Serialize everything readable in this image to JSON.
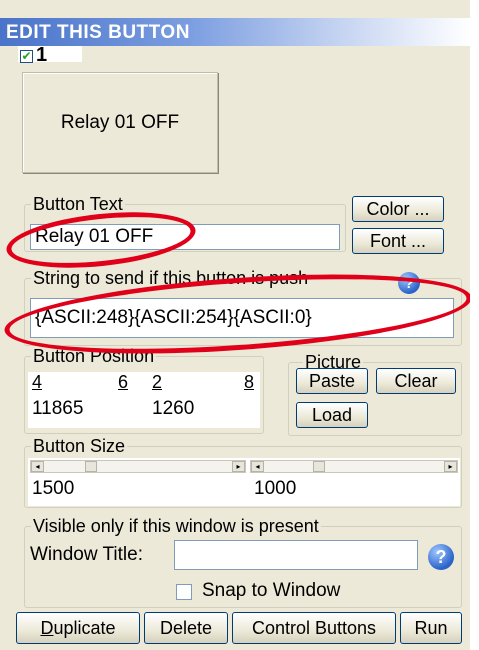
{
  "title": "EDIT THIS BUTTON",
  "button_number": "1",
  "button_enabled_checked": true,
  "preview_label": "Relay 01 OFF",
  "button_text": {
    "legend": "Button Text",
    "value": "Relay 01 OFF",
    "color_button": "Color ...",
    "font_button": "Font ..."
  },
  "string": {
    "legend": "String to send if this button is push",
    "value": "{ASCII:248}{ASCII:254}{ASCII:0}"
  },
  "position": {
    "legend": "Button Position",
    "labels": [
      "4",
      "6",
      "2",
      "8"
    ],
    "x_value": "11865",
    "y_value": "1260"
  },
  "picture": {
    "legend": "Picture",
    "paste": "Paste",
    "clear": "Clear",
    "load": "Load"
  },
  "size": {
    "legend": "Button Size",
    "width_value": "1500",
    "height_value": "1000"
  },
  "visible": {
    "legend": "Visible only if this window is present",
    "window_title_label": "Window Title:",
    "window_title_value": "",
    "snap_label": "Snap to Window",
    "snap_checked": false
  },
  "actions": {
    "duplicate": "Duplicate",
    "delete": "Delete",
    "control_buttons": "Control Buttons",
    "run": "Run"
  },
  "colors": {
    "title_bar": "#4a74c9",
    "window_bg": "#ece9d8",
    "highlight_oval": "#e0001a"
  }
}
